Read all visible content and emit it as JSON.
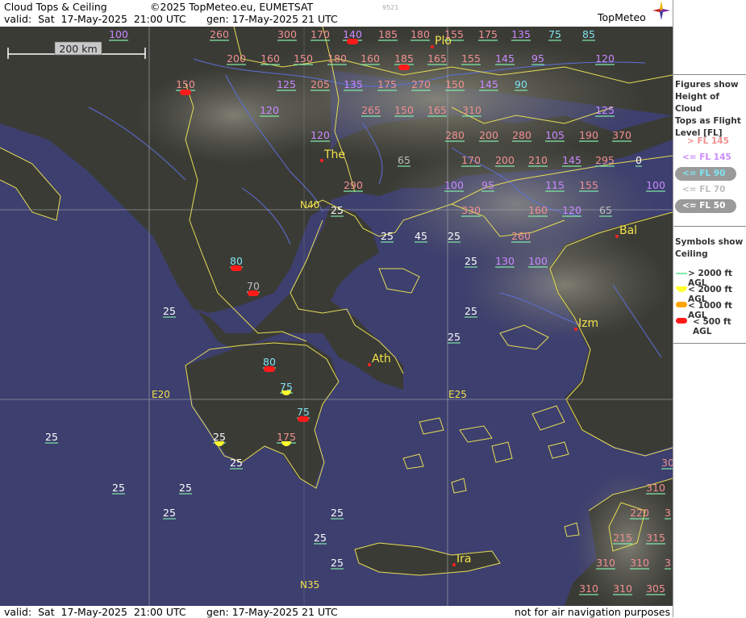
{
  "header": {
    "title": "Cloud Tops & Ceiling",
    "copyright": "©2025 TopMeteo.eu, EUMETSAT",
    "valid": "valid:  Sat  17-May-2025  21:00 UTC",
    "generated": "gen: 17-May-2025 21 UTC",
    "code": "9521",
    "brand": "TopMeteo"
  },
  "footer": {
    "valid": "valid:  Sat  17-May-2025  21:00 UTC",
    "generated": "gen: 17-May-2025 21 UTC",
    "disclaimer": "not for air navigation purposes"
  },
  "map": {
    "scale_label": "200 km",
    "grid_labels": [
      "N40",
      "E20",
      "E25",
      "N35"
    ],
    "cities": [
      "Plo",
      "The",
      "Bal",
      "Izm",
      "Ath",
      "Ira"
    ],
    "colors": {
      "sea": "#3d3f6e",
      "coast": "#e6dd55",
      "river": "#5c6fd8",
      "grid": "#a8a8b0",
      "gt145": "#f09090",
      "le145": "#c98aff",
      "le90": "#7fe3f0",
      "le70": "#bdbdbd",
      "le50": "#ffffff",
      "ceil_gt2000": "#80e8a8",
      "ceil_lt2000": "#ffff30",
      "ceil_lt1000": "#ffa500",
      "ceil_lt500": "#ff1a1a"
    },
    "flight_levels": [
      {
        "v": "100",
        "c": "le145"
      },
      {
        "v": "260",
        "c": "gt145"
      },
      {
        "v": "300",
        "c": "gt145"
      },
      {
        "v": "170",
        "c": "gt145"
      },
      {
        "v": "140",
        "c": "le145"
      },
      {
        "v": "185",
        "c": "gt145"
      },
      {
        "v": "180",
        "c": "gt145"
      },
      {
        "v": "155",
        "c": "gt145"
      },
      {
        "v": "175",
        "c": "gt145"
      },
      {
        "v": "135",
        "c": "le145"
      },
      {
        "v": "75",
        "c": "le90"
      },
      {
        "v": "85",
        "c": "le90"
      },
      {
        "v": "200",
        "c": "gt145"
      },
      {
        "v": "160",
        "c": "gt145"
      },
      {
        "v": "150",
        "c": "gt145"
      },
      {
        "v": "180",
        "c": "gt145"
      },
      {
        "v": "160",
        "c": "gt145"
      },
      {
        "v": "185",
        "c": "gt145"
      },
      {
        "v": "165",
        "c": "gt145"
      },
      {
        "v": "155",
        "c": "gt145"
      },
      {
        "v": "145",
        "c": "le145"
      },
      {
        "v": "95",
        "c": "le145"
      },
      {
        "v": "120",
        "c": "le145"
      },
      {
        "v": "150",
        "c": "gt145"
      },
      {
        "v": "125",
        "c": "le145"
      },
      {
        "v": "205",
        "c": "gt145"
      },
      {
        "v": "135",
        "c": "le145"
      },
      {
        "v": "175",
        "c": "gt145"
      },
      {
        "v": "270",
        "c": "gt145"
      },
      {
        "v": "150",
        "c": "gt145"
      },
      {
        "v": "145",
        "c": "le145"
      },
      {
        "v": "90",
        "c": "le90"
      },
      {
        "v": "120",
        "c": "le145"
      },
      {
        "v": "265",
        "c": "gt145"
      },
      {
        "v": "150",
        "c": "gt145"
      },
      {
        "v": "165",
        "c": "gt145"
      },
      {
        "v": "310",
        "c": "gt145"
      },
      {
        "v": "125",
        "c": "le145"
      },
      {
        "v": "120",
        "c": "le145"
      },
      {
        "v": "280",
        "c": "gt145"
      },
      {
        "v": "200",
        "c": "gt145"
      },
      {
        "v": "280",
        "c": "gt145"
      },
      {
        "v": "105",
        "c": "le145"
      },
      {
        "v": "190",
        "c": "gt145"
      },
      {
        "v": "370",
        "c": "gt145"
      },
      {
        "v": "65",
        "c": "le70"
      },
      {
        "v": "170",
        "c": "gt145"
      },
      {
        "v": "200",
        "c": "gt145"
      },
      {
        "v": "210",
        "c": "gt145"
      },
      {
        "v": "145",
        "c": "le145"
      },
      {
        "v": "295",
        "c": "gt145"
      },
      {
        "v": "0",
        "c": "le50"
      },
      {
        "v": "290",
        "c": "gt145"
      },
      {
        "v": "100",
        "c": "le145"
      },
      {
        "v": "95",
        "c": "le145"
      },
      {
        "v": "115",
        "c": "le145"
      },
      {
        "v": "155",
        "c": "gt145"
      },
      {
        "v": "100",
        "c": "le145"
      },
      {
        "v": "25",
        "c": "le50"
      },
      {
        "v": "330",
        "c": "gt145"
      },
      {
        "v": "160",
        "c": "gt145"
      },
      {
        "v": "120",
        "c": "le145"
      },
      {
        "v": "65",
        "c": "le70"
      },
      {
        "v": "25",
        "c": "le50"
      },
      {
        "v": "45",
        "c": "le50"
      },
      {
        "v": "25",
        "c": "le50"
      },
      {
        "v": "260",
        "c": "gt145"
      },
      {
        "v": "80",
        "c": "le90"
      },
      {
        "v": "25",
        "c": "le50"
      },
      {
        "v": "130",
        "c": "le145"
      },
      {
        "v": "100",
        "c": "le145"
      },
      {
        "v": "70",
        "c": "le70"
      },
      {
        "v": "25",
        "c": "le50"
      },
      {
        "v": "25",
        "c": "le50"
      },
      {
        "v": "25",
        "c": "le50"
      },
      {
        "v": "80",
        "c": "le90"
      },
      {
        "v": "75",
        "c": "le90"
      },
      {
        "v": "75",
        "c": "le90"
      },
      {
        "v": "25",
        "c": "le50"
      },
      {
        "v": "25",
        "c": "le50"
      },
      {
        "v": "175",
        "c": "gt145"
      },
      {
        "v": "25",
        "c": "le50"
      },
      {
        "v": "25",
        "c": "le50"
      },
      {
        "v": "25",
        "c": "le50"
      },
      {
        "v": "310",
        "c": "gt145"
      },
      {
        "v": "25",
        "c": "le50"
      },
      {
        "v": "25",
        "c": "le50"
      },
      {
        "v": "220",
        "c": "gt145"
      },
      {
        "v": "3",
        "c": "gt145"
      },
      {
        "v": "25",
        "c": "le50"
      },
      {
        "v": "215",
        "c": "gt145"
      },
      {
        "v": "315",
        "c": "gt145"
      },
      {
        "v": "25",
        "c": "le50"
      },
      {
        "v": "310",
        "c": "gt145"
      },
      {
        "v": "310",
        "c": "gt145"
      },
      {
        "v": "3",
        "c": "gt145"
      },
      {
        "v": "310",
        "c": "gt145"
      },
      {
        "v": "310",
        "c": "gt145"
      },
      {
        "v": "305",
        "c": "gt145"
      },
      {
        "v": "30",
        "c": "gt145"
      }
    ]
  },
  "legend": {
    "figures_heading": [
      "Figures show",
      "Height of Cloud",
      "Tops as Flight",
      "Level  [FL]"
    ],
    "fl_items": [
      {
        "label": "> FL 145",
        "c": "gt145"
      },
      {
        "label": "<= FL 145",
        "c": "le145"
      },
      {
        "label": "<= FL 90",
        "c": "le90"
      },
      {
        "label": "<= FL 70",
        "c": "le70"
      },
      {
        "label": "<= FL 50",
        "c": "le50"
      }
    ],
    "symbols_heading": [
      "Symbols show",
      "Ceiling"
    ],
    "ceiling_items": [
      {
        "label": "> 2000 ft AGL",
        "c": "ceil_gt2000"
      },
      {
        "label": "< 2000 ft AGL",
        "c": "ceil_lt2000"
      },
      {
        "label": "< 1000 ft AGL",
        "c": "ceil_lt1000"
      },
      {
        "label": "< 500 ft AGL",
        "c": "ceil_lt500"
      }
    ]
  }
}
